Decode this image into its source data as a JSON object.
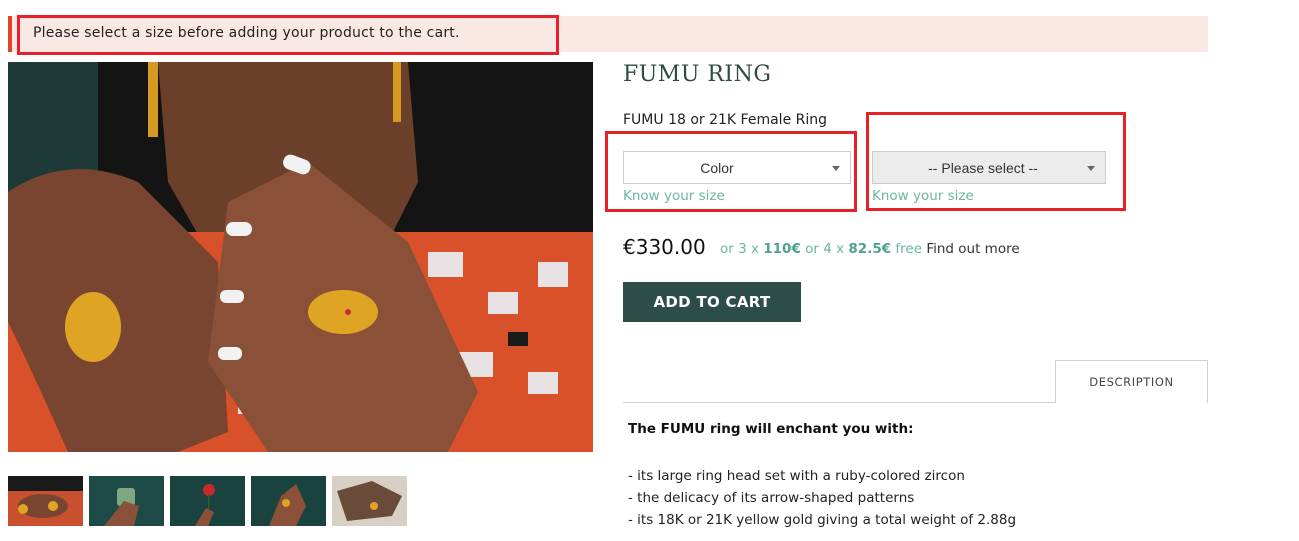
{
  "alert": {
    "message": "Please select a size before adding your product to the cart."
  },
  "product": {
    "title": "FUMU RING",
    "subtitle": "FUMU 18 or 21K Female Ring",
    "color_select": {
      "value": "Color"
    },
    "size_select": {
      "value": "-- Please select --"
    },
    "know_your_size": "Know your size",
    "price": "€330.00",
    "installments": {
      "prefix": "or 3 x ",
      "amount_3": "110€",
      "middle": " or 4 x ",
      "amount_4": "82.5€",
      "suffix": " free ",
      "link": "Find out more"
    },
    "add_to_cart_label": "ADD TO CART"
  },
  "tabs": [
    {
      "label": "DESCRIPTION",
      "active": true
    }
  ],
  "description": {
    "heading": "The FUMU ring will enchant you with:",
    "points": [
      "- its large ring head set with a ruby-colored zircon",
      "- the delicacy of its arrow-shaped patterns",
      "- its 18K or 21K yellow gold giving a total weight of 2.88g"
    ]
  },
  "gallery": {
    "main_image": "woman-hands-wearing-gold-rings-on-patterned-dress",
    "thumbnails": [
      {
        "alt": "hands-with-rings-patterned-dress"
      },
      {
        "alt": "hand-holding-green-mug"
      },
      {
        "alt": "hand-holding-red-rose"
      },
      {
        "alt": "hand-with-gold-ring"
      },
      {
        "alt": "henna-hand-with-ring"
      }
    ]
  },
  "colors": {
    "accent_green": "#2d4d48",
    "link_teal": "#6bb5a4",
    "alert_bg": "#f9e8e4",
    "alert_border": "#e8402a"
  }
}
